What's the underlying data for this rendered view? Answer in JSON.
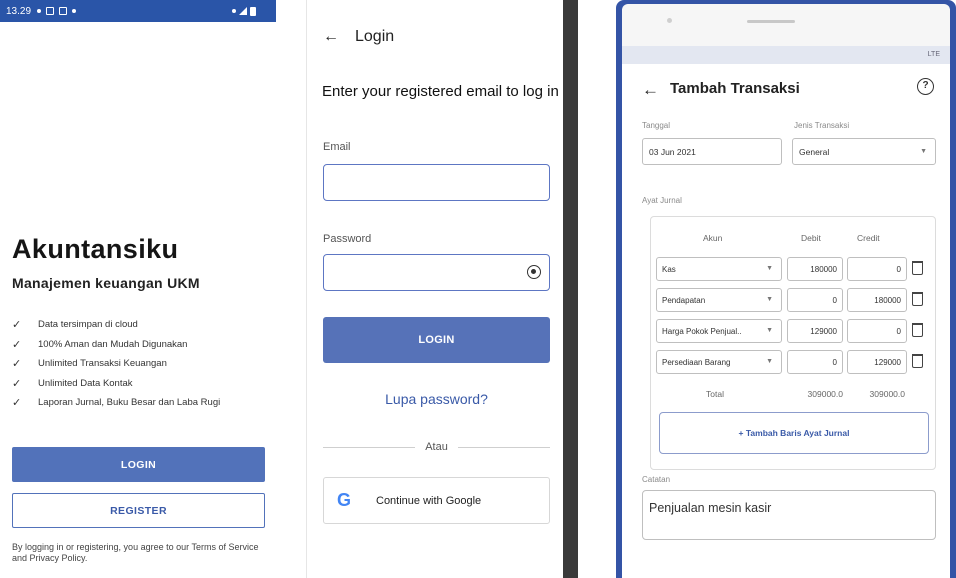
{
  "screen1": {
    "status_time": "13.29",
    "title": "Akuntansiku",
    "subtitle": "Manajemen keuangan UKM",
    "features": [
      "Data tersimpan di cloud",
      "100% Aman dan Mudah Digunakan",
      "Unlimited Transaksi Keuangan",
      "Unlimited Data Kontak",
      "Laporan Jurnal, Buku Besar dan Laba Rugi"
    ],
    "login_label": "LOGIN",
    "register_label": "REGISTER",
    "terms": "By logging in or registering, you agree to our Terms of Service and Privacy Policy."
  },
  "screen2": {
    "header_title": "Login",
    "heading": "Enter your registered email to log in",
    "email_label": "Email",
    "email_value": "",
    "password_label": "Password",
    "password_value": "",
    "login_label": "LOGIN",
    "forgot_label": "Lupa password?",
    "divider_text": "Atau",
    "google_label": "Continue with Google",
    "google_glyph": "G"
  },
  "screen3": {
    "status_text": "LTE",
    "title": "Tambah Transaksi",
    "help_glyph": "?",
    "date_label": "Tanggal",
    "date_value": "03 Jun 2021",
    "type_label": "Jenis Transaksi",
    "type_value": "General",
    "journal_label": "Ayat Jurnal",
    "col_account": "Akun",
    "col_debit": "Debit",
    "col_credit": "Credit",
    "rows": [
      {
        "account": "Kas",
        "debit": "180000",
        "credit": "0"
      },
      {
        "account": "Pendapatan",
        "debit": "0",
        "credit": "180000"
      },
      {
        "account": "Harga Pokok Penjual..",
        "debit": "129000",
        "credit": "0"
      },
      {
        "account": "Persediaan Barang",
        "debit": "0",
        "credit": "129000"
      }
    ],
    "total_label": "Total",
    "total_debit": "309000.0",
    "total_credit": "309000.0",
    "add_row_label": "+ Tambah Baris Ayat Jurnal",
    "notes_label": "Catatan",
    "notes_value": "Penjualan mesin kasir"
  }
}
